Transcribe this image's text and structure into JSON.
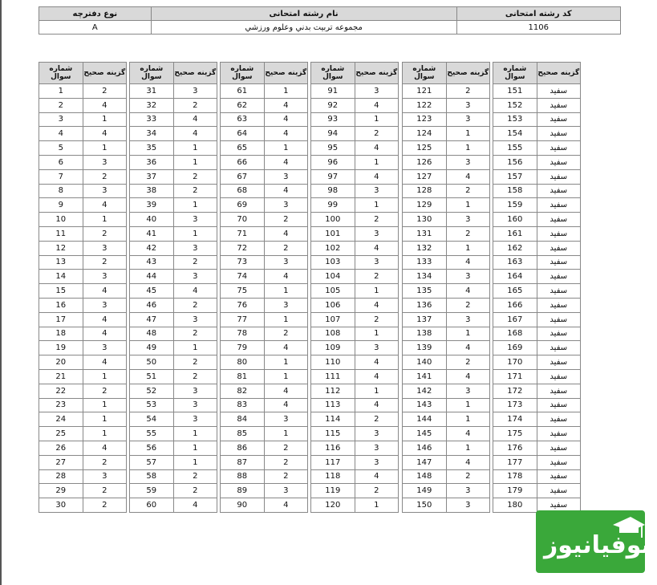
{
  "header": {
    "col1_label": "کد رشته امتحانی",
    "col2_label": "نام رشته امتحانی",
    "col3_label": "نوع دفترچه",
    "code": "1106",
    "field_name": "مجموعه تربيت بدني وعلوم ورزشي",
    "booklet_type": "A"
  },
  "column_headers": {
    "question_number": "شماره سوال",
    "correct_option": "گزینه صحیح"
  },
  "tables": [
    {
      "answers": [
        "2",
        "4",
        "1",
        "4",
        "1",
        "3",
        "2",
        "3",
        "4",
        "1",
        "2",
        "3",
        "2",
        "3",
        "4",
        "3",
        "4",
        "4",
        "3",
        "4",
        "1",
        "2",
        "1",
        "1",
        "1",
        "4",
        "2",
        "3",
        "2",
        "2"
      ]
    },
    {
      "answers": [
        "3",
        "2",
        "4",
        "4",
        "1",
        "1",
        "2",
        "2",
        "1",
        "3",
        "1",
        "3",
        "2",
        "3",
        "4",
        "2",
        "3",
        "2",
        "1",
        "2",
        "2",
        "3",
        "3",
        "3",
        "1",
        "1",
        "1",
        "2",
        "2",
        "4"
      ]
    },
    {
      "answers": [
        "1",
        "4",
        "4",
        "4",
        "1",
        "4",
        "3",
        "4",
        "3",
        "2",
        "4",
        "2",
        "3",
        "4",
        "1",
        "3",
        "1",
        "2",
        "4",
        "1",
        "1",
        "4",
        "4",
        "3",
        "1",
        "2",
        "2",
        "2",
        "3",
        "4"
      ]
    },
    {
      "answers": [
        "3",
        "4",
        "1",
        "2",
        "4",
        "1",
        "4",
        "3",
        "1",
        "2",
        "3",
        "4",
        "3",
        "2",
        "1",
        "4",
        "2",
        "1",
        "3",
        "4",
        "4",
        "1",
        "4",
        "2",
        "3",
        "3",
        "3",
        "4",
        "2",
        "1"
      ]
    },
    {
      "answers": [
        "2",
        "3",
        "3",
        "1",
        "1",
        "3",
        "4",
        "2",
        "1",
        "3",
        "2",
        "1",
        "4",
        "3",
        "4",
        "2",
        "3",
        "1",
        "4",
        "2",
        "4",
        "3",
        "1",
        "1",
        "4",
        "1",
        "4",
        "2",
        "3",
        "3"
      ]
    },
    {
      "answers": [
        "سفيد",
        "سفيد",
        "سفيد",
        "سفيد",
        "سفيد",
        "سفيد",
        "سفيد",
        "سفيد",
        "سفيد",
        "سفيد",
        "سفيد",
        "سفيد",
        "سفيد",
        "سفيد",
        "سفيد",
        "سفيد",
        "سفيد",
        "سفيد",
        "سفيد",
        "سفيد",
        "سفيد",
        "سفيد",
        "سفيد",
        "سفيد",
        "سفيد",
        "سفيد",
        "سفيد",
        "سفيد",
        "سفيد",
        "سفيد"
      ]
    }
  ],
  "logo_text": "سوفیانیوز",
  "colors": {
    "header_bg": "#d9d9d9",
    "logo_bg": "#3aa83a"
  }
}
